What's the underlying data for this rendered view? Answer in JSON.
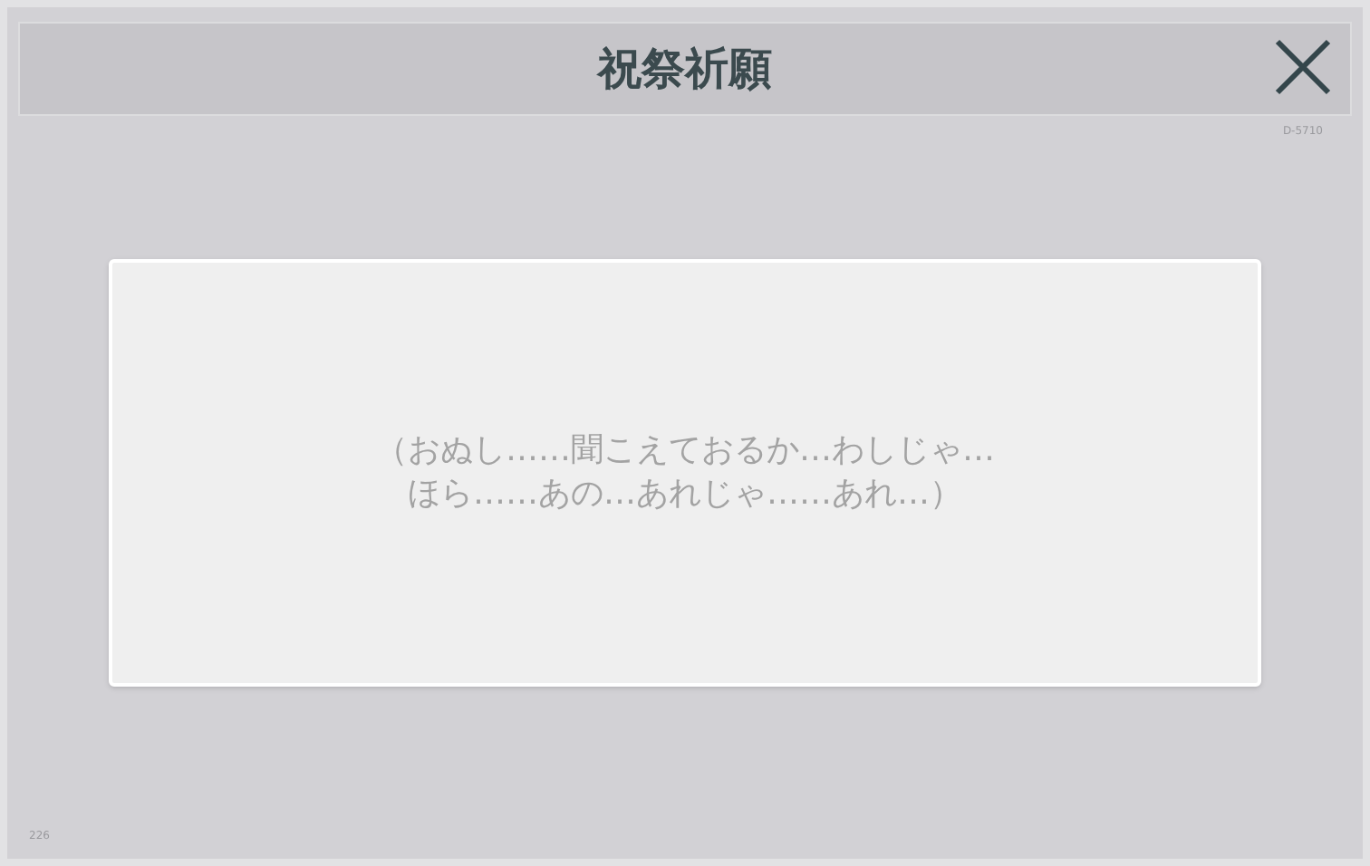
{
  "header": {
    "title": "祝祭祈願",
    "code": "D-5710"
  },
  "message": {
    "lines": [
      "（おぬし……聞こえておるか…わしじゃ…",
      "ほら……あの…あれじゃ……あれ…）"
    ]
  },
  "footer": {
    "number": "226"
  }
}
